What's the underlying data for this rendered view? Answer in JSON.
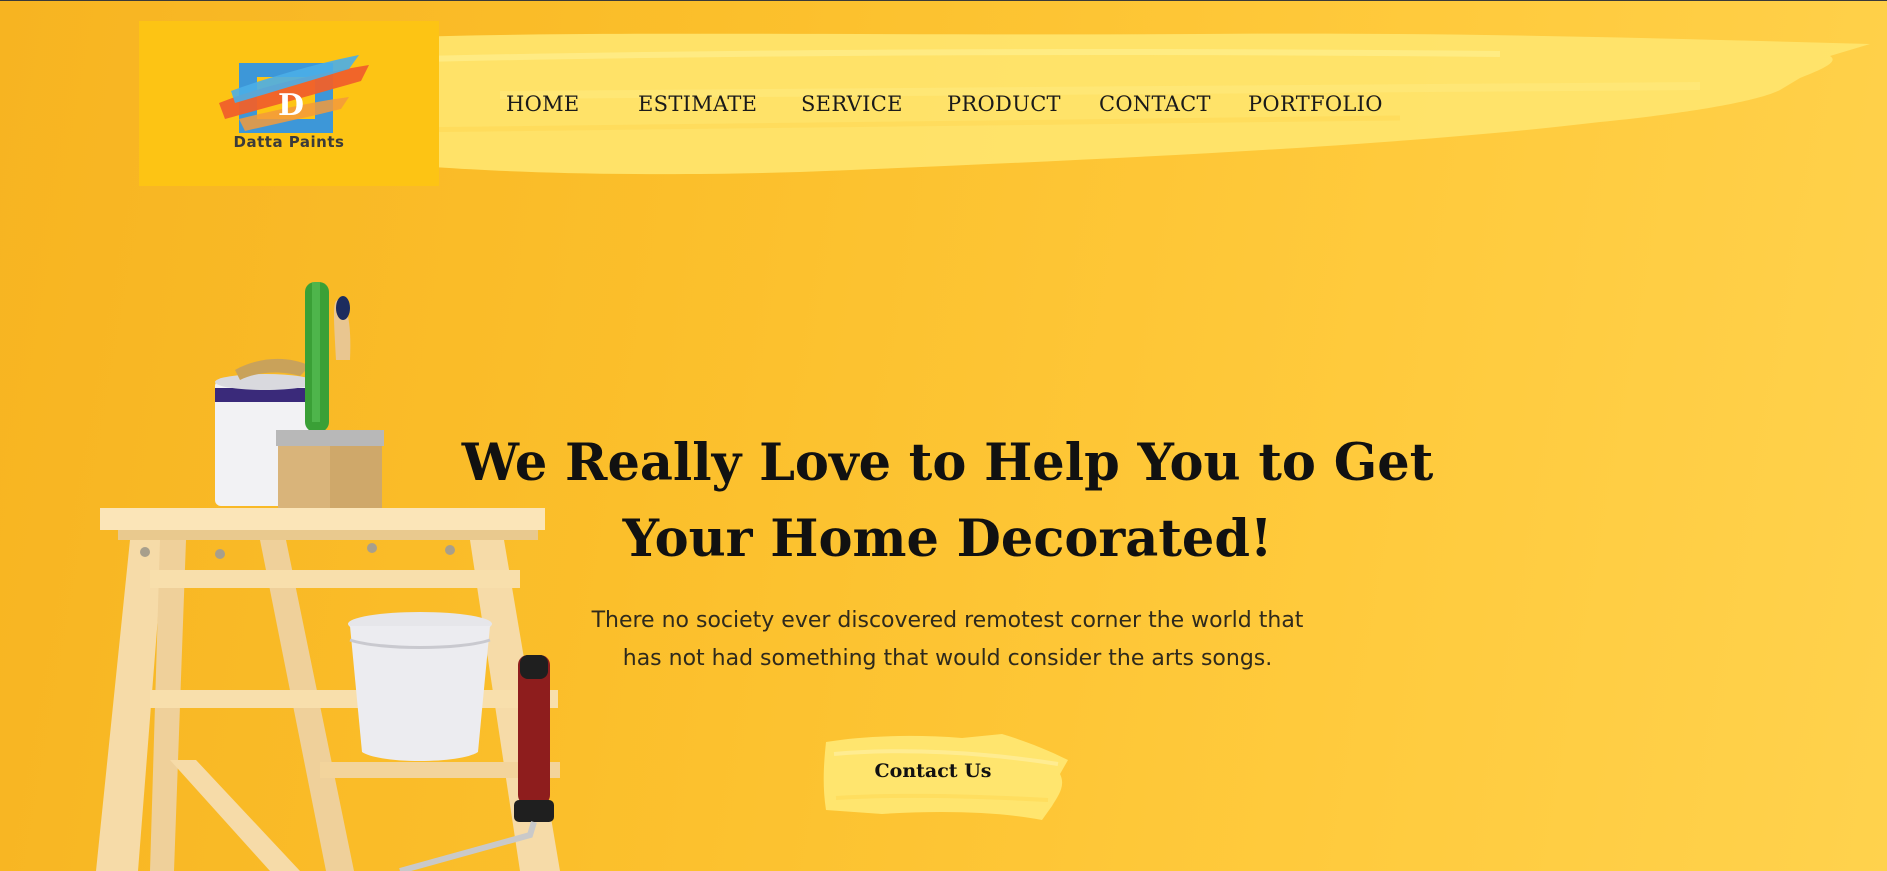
{
  "brand": {
    "logo_letter": "D",
    "name": "Datta Paints"
  },
  "nav": {
    "items": [
      {
        "label": "HOME"
      },
      {
        "label": "ESTIMATE"
      },
      {
        "label": "SERVICE"
      },
      {
        "label": "PRODUCT"
      },
      {
        "label": "CONTACT"
      },
      {
        "label": "PORTFOLIO"
      }
    ]
  },
  "hero": {
    "title_line1": "We Really Love to Help You to Get",
    "title_line2": "Your Home Decorated!",
    "subtitle_line1": "There no society ever discovered remotest corner the world that",
    "subtitle_line2": "has not had something that would consider the arts songs.",
    "cta_label": "Contact Us"
  },
  "colors": {
    "background": "#fbbf2b",
    "brush_highlight": "#ffe56e",
    "logo_bg": "#fdc414",
    "text_dark": "#111111"
  }
}
